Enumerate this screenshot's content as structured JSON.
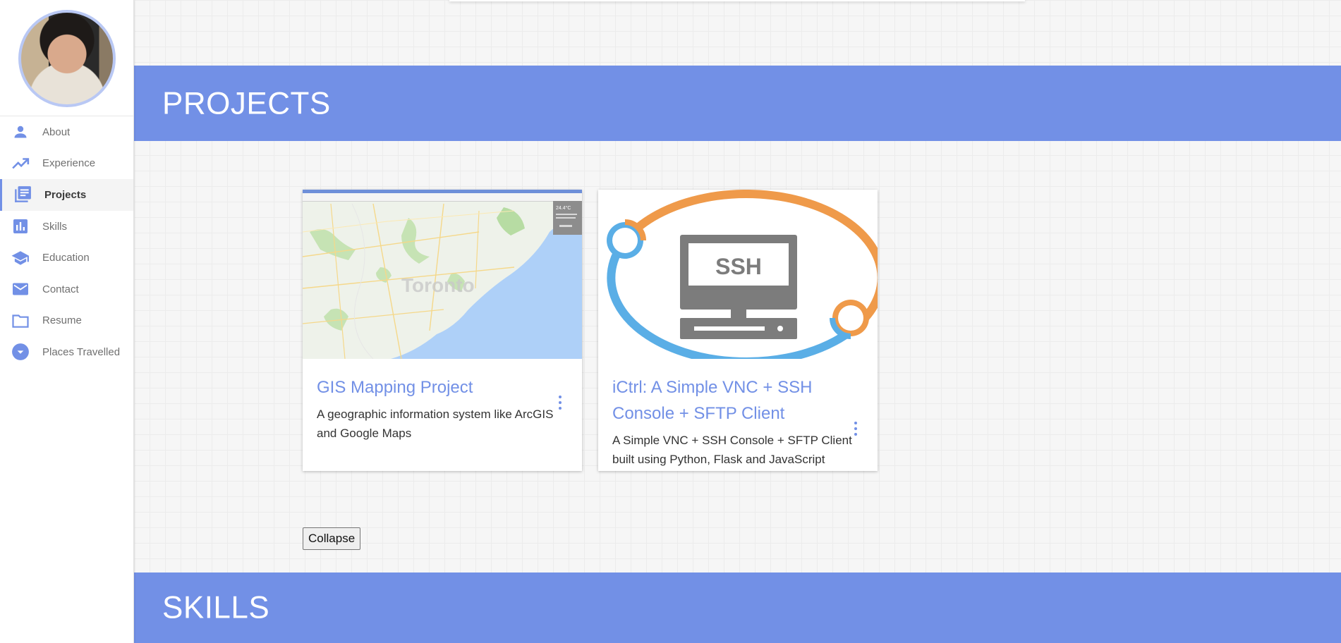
{
  "sidebar": {
    "avatar_alt": "profile photo",
    "items": [
      {
        "label": "About",
        "icon": "person-icon"
      },
      {
        "label": "Experience",
        "icon": "trending-up-icon"
      },
      {
        "label": "Projects",
        "icon": "library-books-icon",
        "active": true
      },
      {
        "label": "Skills",
        "icon": "bar-chart-icon"
      },
      {
        "label": "Education",
        "icon": "school-icon"
      },
      {
        "label": "Contact",
        "icon": "mail-icon"
      },
      {
        "label": "Resume",
        "icon": "folder-icon"
      },
      {
        "label": "Places Travelled",
        "icon": "chevron-circle-icon"
      }
    ]
  },
  "sections": {
    "projects_title": "PROJECTS",
    "skills_title": "SKILLS"
  },
  "projects": [
    {
      "title": "GIS Mapping Project",
      "description": "A geographic information system like ArcGIS and Google Maps",
      "image": "map-of-toronto-screenshot",
      "map_label": "Toronto",
      "weather_temp": "24.4°C"
    },
    {
      "title": "iCtrl: A Simple VNC + SSH Console + SFTP Client",
      "description": "A Simple VNC + SSH Console + SFTP Client built using Python, Flask and JavaScript",
      "image": "ssh-computer-logo",
      "logo_text": "SSH"
    }
  ],
  "collapse_label": "Collapse",
  "colors": {
    "accent": "#7290e6",
    "logo_orange": "#ef9a4a",
    "logo_blue": "#5aaee6",
    "logo_gray": "#7c7c7c"
  }
}
